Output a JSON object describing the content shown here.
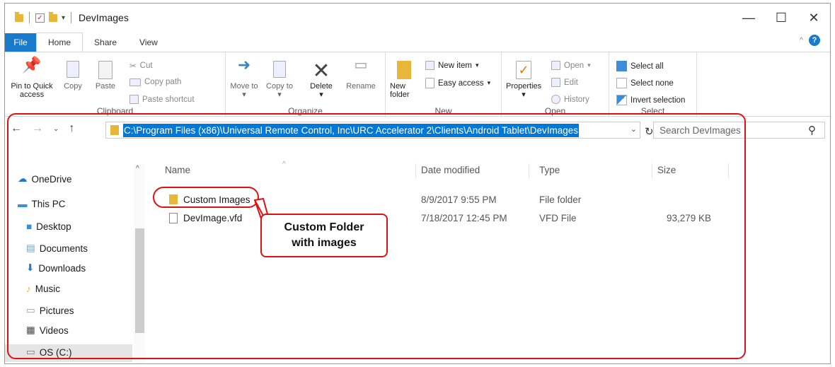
{
  "window": {
    "title": "DevImages"
  },
  "tabs": [
    {
      "label": "File"
    },
    {
      "label": "Home"
    },
    {
      "label": "Share"
    },
    {
      "label": "View"
    }
  ],
  "ribbon": {
    "clipboard": {
      "pin_label": "Pin to Quick access",
      "copy_label": "Copy",
      "paste_label": "Paste",
      "cut_label": "Cut",
      "copy_path_label": "Copy path",
      "paste_shortcut_label": "Paste shortcut",
      "group_label": "Clipboard"
    },
    "organize": {
      "move_label": "Move to",
      "copy_label": "Copy to",
      "delete_label": "Delete",
      "rename_label": "Rename",
      "group_label": "Organize"
    },
    "new": {
      "new_folder_label": "New folder",
      "new_item_label": "New item",
      "easy_access_label": "Easy access",
      "group_label": "New"
    },
    "open": {
      "properties_label": "Properties",
      "open_label": "Open",
      "edit_label": "Edit",
      "history_label": "History",
      "group_label": "Open"
    },
    "select": {
      "select_all_label": "Select all",
      "select_none_label": "Select none",
      "invert_label": "Invert selection",
      "group_label": "Select"
    }
  },
  "address": {
    "path": "C:\\Program Files (x86)\\Universal Remote Control, Inc\\URC Accelerator 2\\Clients\\Android Tablet\\DevImages",
    "search_placeholder": "Search DevImages"
  },
  "nav": {
    "items": [
      {
        "label": "OneDrive"
      },
      {
        "label": "This PC"
      },
      {
        "label": "Desktop"
      },
      {
        "label": "Documents"
      },
      {
        "label": "Downloads"
      },
      {
        "label": "Music"
      },
      {
        "label": "Pictures"
      },
      {
        "label": "Videos"
      },
      {
        "label": "OS (C:)"
      }
    ]
  },
  "columns": {
    "name": "Name",
    "date": "Date modified",
    "type": "Type",
    "size": "Size"
  },
  "files": [
    {
      "name": "Custom Images",
      "date": "8/9/2017 9:55 PM",
      "type": "File folder",
      "size": ""
    },
    {
      "name": "DevImage.vfd",
      "date": "7/18/2017 12:45 PM",
      "type": "VFD File",
      "size": "93,279 KB"
    }
  ],
  "annotation": {
    "line1": "Custom Folder",
    "line2": "with images"
  },
  "colors": {
    "accent": "#0078d7",
    "file_tab": "#1979ca",
    "annotation_red": "#d11",
    "folder": "#e8b73a"
  }
}
